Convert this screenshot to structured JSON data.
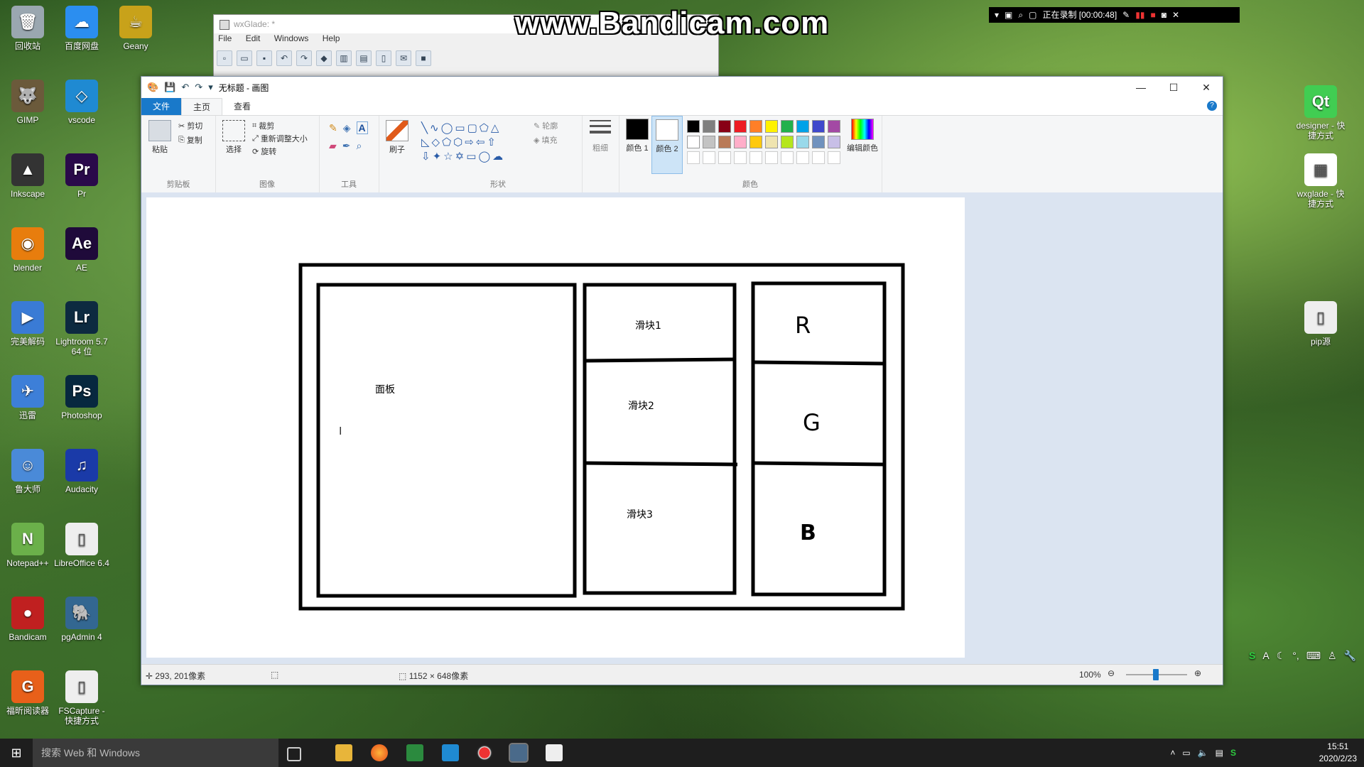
{
  "desktop": {
    "left_icons": [
      {
        "label": "回收站",
        "color": "#9aa7b0",
        "glyph": "🗑"
      },
      {
        "label": "百度网盘",
        "color": "#2b8ef0",
        "glyph": "☁"
      },
      {
        "label": "Geany",
        "color": "#c8a21a",
        "glyph": "☕"
      },
      {
        "label": "GIMP",
        "color": "#6b5a3b",
        "glyph": "🐺"
      },
      {
        "label": "vscode",
        "color": "#1f8ad2",
        "glyph": "◇"
      },
      {
        "label": "Inkscape",
        "color": "#333333",
        "glyph": "▲"
      },
      {
        "label": "Pr",
        "color": "#2a0a4a",
        "glyph": "Pr"
      },
      {
        "label": "blender",
        "color": "#e87d0d",
        "glyph": "◉"
      },
      {
        "label": "AE",
        "color": "#1f0a3a",
        "glyph": "Ae"
      },
      {
        "label": "完美解码",
        "color": "#3a7bd5",
        "glyph": "▶"
      },
      {
        "label": "Lightroom 5.7 64 位",
        "color": "#0d2a40",
        "glyph": "Lr"
      },
      {
        "label": "迅雷",
        "color": "#3d7fd8",
        "glyph": "✈"
      },
      {
        "label": "Photoshop",
        "color": "#07283f",
        "glyph": "Ps"
      },
      {
        "label": "鲁大师",
        "color": "#4a8ad8",
        "glyph": "☺"
      },
      {
        "label": "Audacity",
        "color": "#1a3aa8",
        "glyph": "♫"
      },
      {
        "label": "Notepad++",
        "color": "#6bb04a",
        "glyph": "N"
      },
      {
        "label": "LibreOffice 6.4",
        "color": "#eeeeee",
        "glyph": "▯"
      },
      {
        "label": "Bandicam",
        "color": "#c02020",
        "glyph": "●"
      },
      {
        "label": "pgAdmin 4",
        "color": "#336791",
        "glyph": "🐘"
      },
      {
        "label": "福昕阅读器",
        "color": "#e8601a",
        "glyph": "G"
      },
      {
        "label": "FSCapture - 快捷方式",
        "color": "#eeeeee",
        "glyph": "▯"
      }
    ],
    "right_icons": [
      {
        "label": "designer - 快捷方式",
        "color": "#41cd52",
        "glyph": "Qt"
      },
      {
        "label": "wxglade - 快捷方式",
        "color": "#ffffff",
        "glyph": "▦"
      },
      {
        "label": "pip源",
        "color": "#eeeeee",
        "glyph": "▯"
      }
    ]
  },
  "wxglade": {
    "title": "wxGlade: *",
    "menu": [
      "File",
      "Edit",
      "Windows",
      "Help"
    ]
  },
  "recorder": {
    "watermark": "www.Bandicam.com",
    "status": "正在录制 [00:00:48]"
  },
  "paint": {
    "title": "无标题 - 画图",
    "tabs": {
      "file": "文件",
      "home": "主页",
      "view": "查看"
    },
    "clipboard": {
      "paste": "粘贴",
      "cut": "剪切",
      "copy": "复制",
      "label": "剪贴板"
    },
    "image": {
      "select": "选择",
      "crop": "裁剪",
      "resize": "重新调整大小",
      "rotate": "旋转",
      "label": "图像"
    },
    "tools": {
      "label": "工具"
    },
    "brushes": {
      "label": "刷子"
    },
    "shapes": {
      "outline": "轮廓",
      "fill": "填充",
      "label": "形状"
    },
    "size": {
      "label": "粗细"
    },
    "colors": {
      "color1": "颜色 1",
      "color2": "颜色 2",
      "edit": "编辑颜色",
      "label": "颜色"
    },
    "palette_row1": [
      "#000000",
      "#7f7f7f",
      "#880015",
      "#ed1c24",
      "#ff7f27",
      "#fff200",
      "#22b14c",
      "#00a2e8",
      "#3f48cc",
      "#a349a4"
    ],
    "palette_row2": [
      "#ffffff",
      "#c3c3c3",
      "#b97a57",
      "#ffaec9",
      "#ffc90e",
      "#efe4b0",
      "#b5e61d",
      "#99d9ea",
      "#7092be",
      "#c8bfe7"
    ],
    "status": {
      "cursor": "293, 201像素",
      "size": "1152 × 648像素",
      "zoom": "100%"
    },
    "drawing": {
      "panel": "面板",
      "slider1": "滑块1",
      "slider2": "滑块2",
      "slider3": "滑块3",
      "r": "R",
      "g": "G",
      "b": "B"
    }
  },
  "taskbar": {
    "search": "搜索 Web 和 Windows",
    "time": "15:51",
    "date": "2020/2/23"
  }
}
